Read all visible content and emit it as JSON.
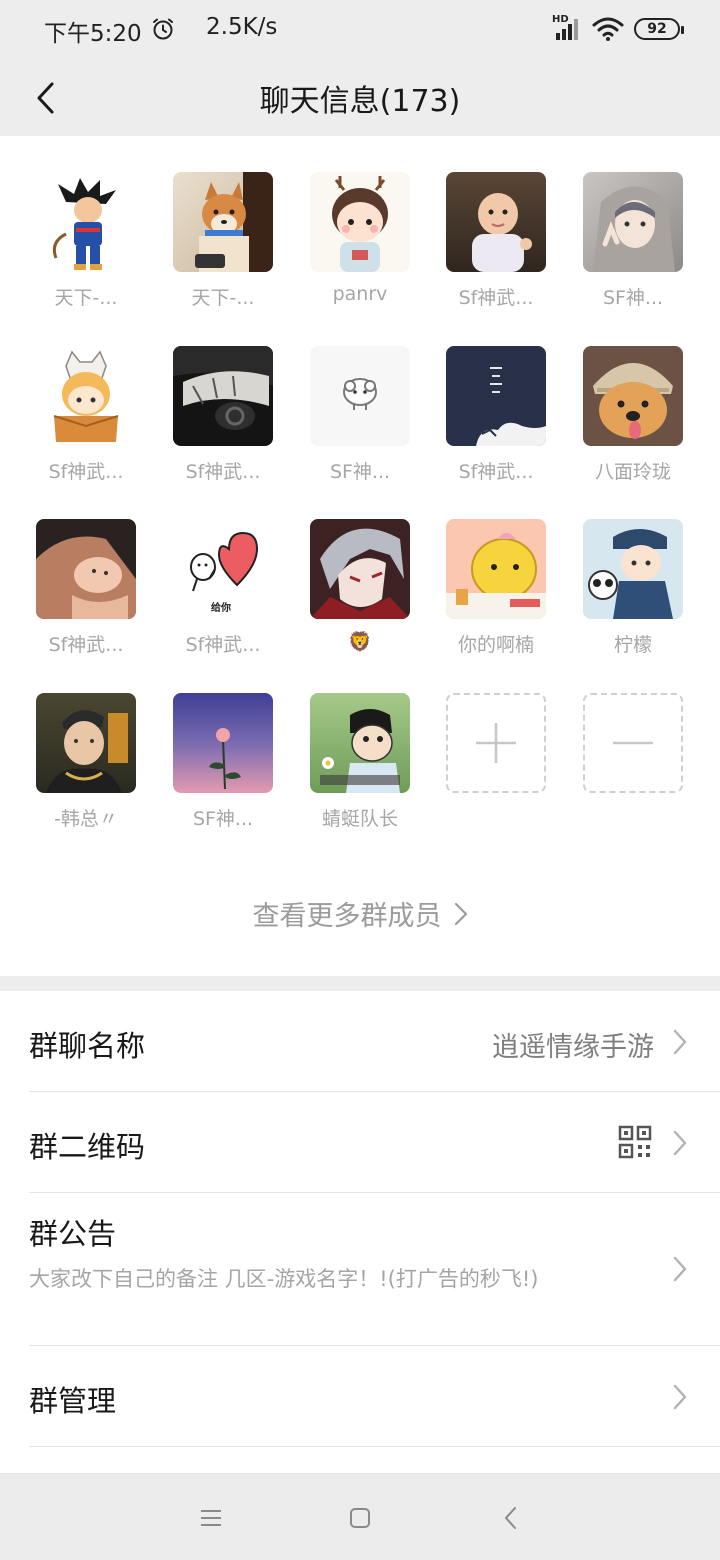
{
  "status_bar": {
    "time": "下午5:20",
    "net_speed": "2.5K/s",
    "hd_label": "HD",
    "battery": "92",
    "icons": [
      "alarm-icon",
      "signal-icon",
      "wifi-icon",
      "battery-icon"
    ]
  },
  "header": {
    "title": "聊天信息(173)",
    "back_icon": "chevron-left-icon"
  },
  "members": [
    {
      "name": "天下-...",
      "avatar": "avatar-goku-cartoon"
    },
    {
      "name": "天下-...",
      "avatar": "avatar-shiba-dog"
    },
    {
      "name": "panrv",
      "avatar": "avatar-cartoon-child"
    },
    {
      "name": "Sf神武...",
      "avatar": "avatar-baby-photo"
    },
    {
      "name": "SF神...",
      "avatar": "avatar-anime-portrait"
    },
    {
      "name": "Sf神武...",
      "avatar": "avatar-cat-in-box"
    },
    {
      "name": "Sf神武...",
      "avatar": "avatar-car-interior"
    },
    {
      "name": "SF神...",
      "avatar": "avatar-sheep"
    },
    {
      "name": "Sf神武...",
      "avatar": "avatar-dark-calligraphy"
    },
    {
      "name": "八面玲珑",
      "avatar": "avatar-dog-beanie"
    },
    {
      "name": "Sf神武...",
      "avatar": "avatar-parent-baby"
    },
    {
      "name": "Sf神武...",
      "avatar": "avatar-heart-sticker",
      "sticker_text": "给你"
    },
    {
      "name": "🦁",
      "avatar": "avatar-anime-boy"
    },
    {
      "name": "你的啊楠",
      "avatar": "avatar-yellow-cat"
    },
    {
      "name": "柠檬",
      "avatar": "avatar-chibi-panda"
    },
    {
      "name": "-韩总〃",
      "avatar": "avatar-man-photo"
    },
    {
      "name": "SF神...",
      "avatar": "avatar-flower-sky"
    },
    {
      "name": "蜻蜓队长",
      "avatar": "avatar-crayon-character"
    }
  ],
  "member_actions": {
    "add_icon": "plus-icon",
    "remove_icon": "minus-icon"
  },
  "view_more": {
    "label": "查看更多群成员",
    "icon": "chevron-right-icon"
  },
  "settings": {
    "group_name": {
      "label": "群聊名称",
      "value": "逍遥情缘手游"
    },
    "qr_code": {
      "label": "群二维码",
      "icon": "qr-code-icon"
    },
    "announcement": {
      "label": "群公告",
      "text": "大家改下自己的备注  几区-游戏名字！!(打广告的秒飞!)"
    },
    "management": {
      "label": "群管理"
    }
  },
  "navbar": {
    "icons": [
      "menu-icon",
      "home-icon",
      "back-icon"
    ]
  }
}
